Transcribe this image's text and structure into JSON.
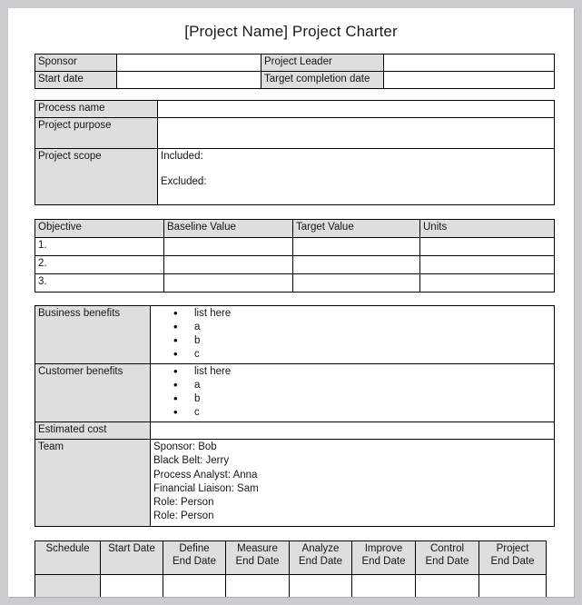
{
  "document": {
    "title": "[Project Name] Project Charter"
  },
  "header_table": {
    "rows": [
      {
        "label_left": "Sponsor",
        "value_left": "",
        "label_right": "Project Leader",
        "value_right": ""
      },
      {
        "label_left": "Start date",
        "value_left": "",
        "label_right": "Target completion date",
        "value_right": ""
      }
    ]
  },
  "process_table": {
    "rows": [
      {
        "label": "Process name",
        "value": ""
      },
      {
        "label": "Project purpose",
        "value": ""
      }
    ],
    "scope": {
      "label": "Project scope",
      "included_label": "Included:",
      "excluded_label": "Excluded:"
    }
  },
  "objectives_table": {
    "columns": [
      "Objective",
      "Baseline Value",
      "Target Value",
      "Units"
    ],
    "rows": [
      {
        "objective": "1.",
        "baseline": "",
        "target": "",
        "units": ""
      },
      {
        "objective": "2.",
        "baseline": "",
        "target": "",
        "units": ""
      },
      {
        "objective": "3.",
        "baseline": "",
        "target": "",
        "units": ""
      }
    ]
  },
  "benefits_table": {
    "business": {
      "label": "Business benefits",
      "items": [
        "list here",
        "a",
        "b",
        "c"
      ]
    },
    "customer": {
      "label": "Customer benefits",
      "items": [
        "list here",
        "a",
        "b",
        "c"
      ]
    },
    "estimated_cost": {
      "label": "Estimated cost",
      "value": ""
    },
    "team": {
      "label": "Team",
      "members": [
        "Sponsor: Bob",
        "Black Belt: Jerry",
        "Process Analyst: Anna",
        "Financial Liaison: Sam",
        "Role: Person",
        "Role: Person"
      ]
    }
  },
  "schedule_table": {
    "columns": [
      "Schedule",
      "Start Date",
      "Define\nEnd Date",
      "Measure\nEnd Date",
      "Analyze\nEnd Date",
      "Improve\nEnd Date",
      "Control\nEnd Date",
      "Project\nEnd Date"
    ],
    "columns_line1": [
      "Schedule",
      "Start Date",
      "Define",
      "Measure",
      "Analyze",
      "Improve",
      "Control",
      "Project"
    ],
    "columns_line2": [
      "",
      "",
      "End Date",
      "End Date",
      "End Date",
      "End Date",
      "End Date",
      "End Date"
    ],
    "data_row": [
      "",
      "",
      "",
      "",
      "",
      "",
      "",
      ""
    ]
  },
  "colors": {
    "page_background": "#c9cbcc",
    "page": "#ffffff",
    "cell_shade": "#dedede",
    "border": "#000000",
    "text": "#161616"
  }
}
